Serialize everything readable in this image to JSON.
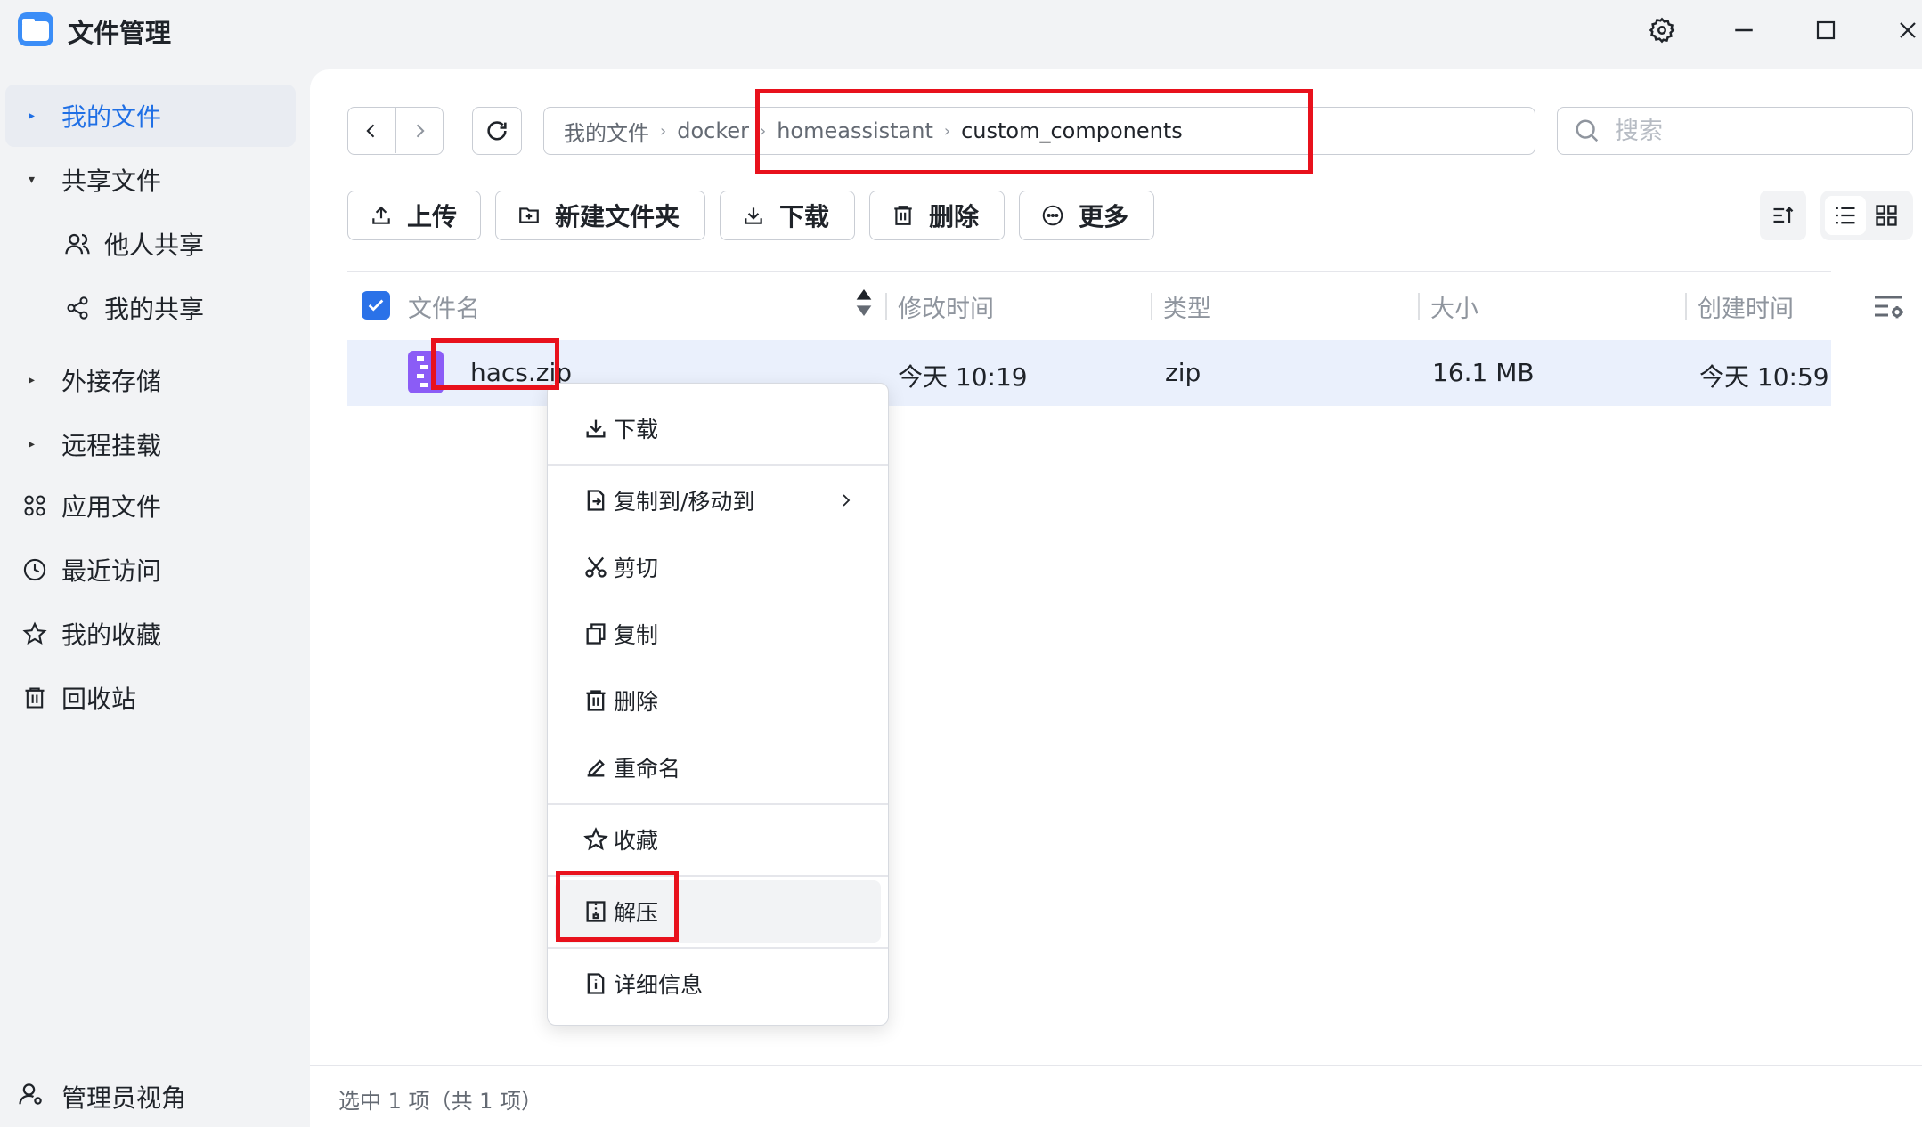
{
  "app": {
    "title": "文件管理"
  },
  "sidebar": {
    "items": [
      {
        "label": "我的文件"
      },
      {
        "label": "共享文件"
      },
      {
        "label": "他人共享"
      },
      {
        "label": "我的共享"
      },
      {
        "label": "外接存储"
      },
      {
        "label": "远程挂载"
      },
      {
        "label": "应用文件"
      },
      {
        "label": "最近访问"
      },
      {
        "label": "我的收藏"
      },
      {
        "label": "回收站"
      }
    ],
    "admin_label": "管理员视角"
  },
  "breadcrumb": {
    "parts": [
      "我的文件",
      "docker",
      "homeassistant",
      "custom_components"
    ],
    "separator": "›"
  },
  "search": {
    "placeholder": "搜索"
  },
  "toolbar": {
    "upload": "上传",
    "new_folder": "新建文件夹",
    "download": "下载",
    "delete": "删除",
    "more": "更多"
  },
  "table": {
    "columns": [
      "文件名",
      "修改时间",
      "类型",
      "大小",
      "创建时间"
    ],
    "rows": [
      {
        "name": "hacs.zip",
        "modified": "今天 10:19",
        "type": "zip",
        "size": "16.1 MB",
        "created": "今天 10:59"
      }
    ]
  },
  "context_menu": {
    "items": [
      {
        "label": "下载"
      },
      {
        "label": "复制到/移动到"
      },
      {
        "label": "剪切"
      },
      {
        "label": "复制"
      },
      {
        "label": "删除"
      },
      {
        "label": "重命名"
      },
      {
        "label": "收藏"
      },
      {
        "label": "解压"
      },
      {
        "label": "详细信息"
      }
    ]
  },
  "status": {
    "text": "选中 1 项（共 1 项）"
  },
  "colors": {
    "accent": "#1f6fe5",
    "annotation": "#e8111c",
    "selected_row": "#eaf0fc"
  }
}
